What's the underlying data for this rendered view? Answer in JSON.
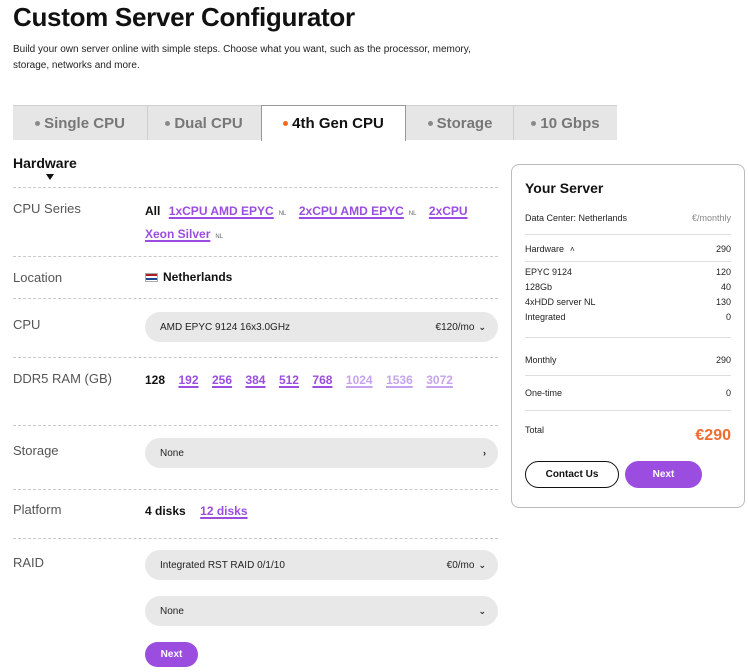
{
  "header": {
    "title": "Custom Server Configurator",
    "subtitle": "Build your own server online with simple steps. Choose what you want, such as the processor, memory, storage, networks and more."
  },
  "tabs": [
    {
      "label": "Single CPU",
      "active": false
    },
    {
      "label": "Dual CPU",
      "active": false
    },
    {
      "label": "4th Gen CPU",
      "active": true
    },
    {
      "label": "Storage",
      "active": false
    },
    {
      "label": "10 Gbps",
      "active": false
    }
  ],
  "hardware": {
    "heading": "Hardware",
    "cpu_series": {
      "label": "CPU Series",
      "options": [
        {
          "label": "All",
          "selected": true,
          "suffix": ""
        },
        {
          "label": "1xCPU AMD EPYC",
          "selected": false,
          "suffix": "NL"
        },
        {
          "label": "2xCPU AMD EPYC",
          "selected": false,
          "suffix": "NL"
        },
        {
          "label": "2xCPU Xeon Silver",
          "selected": false,
          "suffix": "NL"
        }
      ]
    },
    "location": {
      "label": "Location",
      "value": "Netherlands"
    },
    "cpu": {
      "label": "CPU",
      "value": "AMD EPYC 9124 16x3.0GHz",
      "price": "€120/mo"
    },
    "ram": {
      "label": "DDR5 RAM (GB)",
      "options": [
        {
          "label": "128",
          "state": "selected"
        },
        {
          "label": "192",
          "state": "available"
        },
        {
          "label": "256",
          "state": "available"
        },
        {
          "label": "384",
          "state": "available"
        },
        {
          "label": "512",
          "state": "available"
        },
        {
          "label": "768",
          "state": "available"
        },
        {
          "label": "1024",
          "state": "faded"
        },
        {
          "label": "1536",
          "state": "faded"
        },
        {
          "label": "3072",
          "state": "faded"
        }
      ]
    },
    "storage": {
      "label": "Storage",
      "value": "None"
    },
    "platform": {
      "label": "Platform",
      "options": [
        {
          "label": "4 disks",
          "selected": true
        },
        {
          "label": "12 disks",
          "selected": false
        }
      ]
    },
    "raid": {
      "label": "RAID",
      "value": "Integrated RST RAID 0/1/10",
      "price": "€0/mo",
      "secondary_value": "None"
    },
    "next_label": "Next"
  },
  "summary": {
    "title": "Your Server",
    "datacenter_label": "Data Center: Netherlands",
    "unit_label": "€/monthly",
    "hardware_label": "Hardware",
    "hardware_value": "290",
    "items": [
      {
        "label": "EPYC 9124",
        "value": "120"
      },
      {
        "label": "128Gb",
        "value": "40"
      },
      {
        "label": "4xHDD server NL",
        "value": "130"
      },
      {
        "label": "Integrated",
        "value": "0"
      }
    ],
    "monthly_label": "Monthly",
    "monthly_value": "290",
    "onetime_label": "One-time",
    "onetime_value": "0",
    "total_label": "Total",
    "total_value": "€290",
    "contact_label": "Contact Us",
    "next_label": "Next"
  },
  "colors": {
    "accent": "#9b4de0",
    "accent_faded": "#c7a3ef",
    "total": "#ef6b2e",
    "active_tab_dot": "#f06a23"
  }
}
